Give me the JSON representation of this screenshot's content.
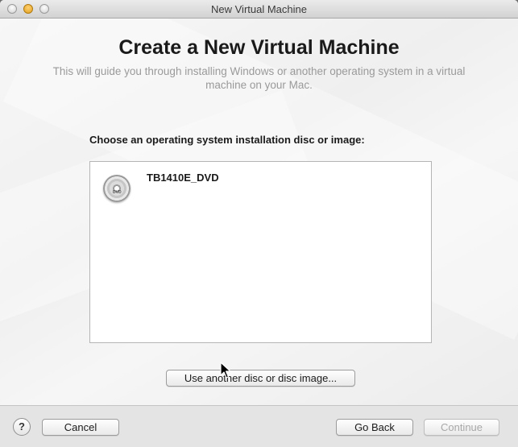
{
  "window": {
    "title": "New Virtual Machine"
  },
  "header": {
    "title": "Create a New Virtual Machine",
    "subtitle": "This will guide you through installing Windows or another operating system in a virtual machine on your Mac."
  },
  "install": {
    "label": "Choose an operating system installation disc or image:",
    "discs": [
      {
        "name": "TB1410E_DVD",
        "icon": "dvd-disc-icon",
        "disc_badge": "DVD"
      }
    ],
    "other_button": "Use another disc or disc image..."
  },
  "footer": {
    "help_label": "?",
    "cancel": "Cancel",
    "go_back": "Go Back",
    "continue": "Continue"
  }
}
